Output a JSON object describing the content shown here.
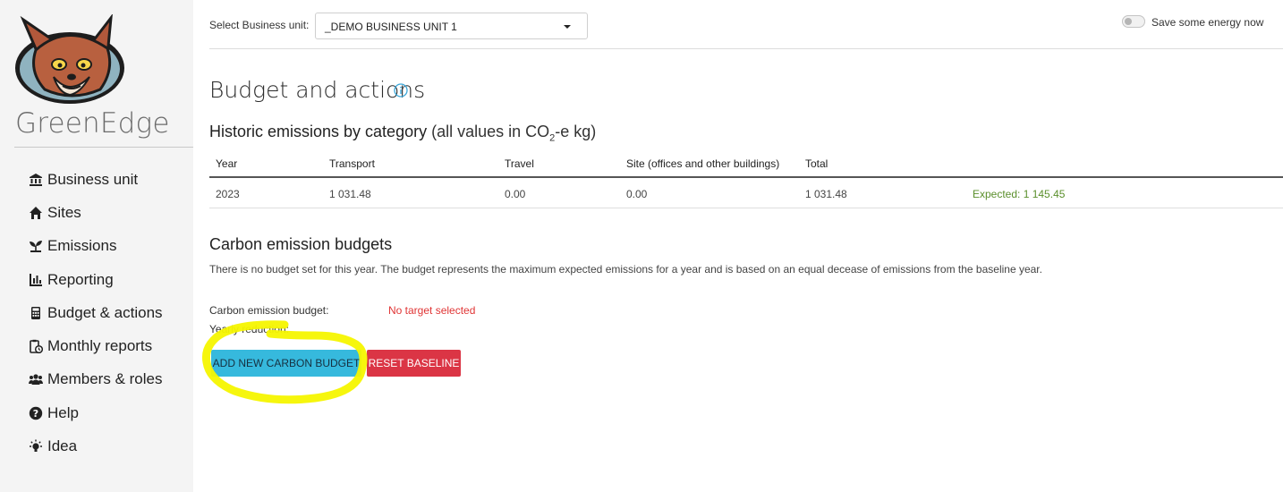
{
  "brand": {
    "name": "GreenEdge"
  },
  "nav": {
    "items": [
      {
        "label": "Business unit",
        "icon": "bank-icon"
      },
      {
        "label": "Sites",
        "icon": "home-icon"
      },
      {
        "label": "Emissions",
        "icon": "seedling-icon"
      },
      {
        "label": "Reporting",
        "icon": "bar-chart-icon"
      },
      {
        "label": "Budget & actions",
        "icon": "calculator-icon"
      },
      {
        "label": "Monthly reports",
        "icon": "report-clock-icon"
      },
      {
        "label": "Members & roles",
        "icon": "users-icon"
      },
      {
        "label": "Help",
        "icon": "question-circle-icon"
      },
      {
        "label": "Idea",
        "icon": "lightbulb-icon"
      }
    ]
  },
  "topbar": {
    "select_label": "Select Business unit:",
    "selected_unit": "_DEMO BUSINESS UNIT 1",
    "energy_label": "Save some energy now",
    "energy_on": false
  },
  "page": {
    "title": "Budget and actions",
    "historic": {
      "title": "Historic emissions by category",
      "subtitle_prefix": "(all values in CO",
      "subtitle_sub": "2",
      "subtitle_suffix": "-e kg)",
      "columns": [
        "Year",
        "Transport",
        "Travel",
        "Site (offices and other buildings)",
        "Total",
        ""
      ],
      "rows": [
        {
          "year": "2023",
          "transport": "1 031.48",
          "travel": "0.00",
          "site": "0.00",
          "total": "1 031.48",
          "expected": "Expected: 1 145.45"
        }
      ]
    },
    "budgets": {
      "title": "Carbon emission budgets",
      "description": "There is no budget set for this year. The budget represents the maximum expected emissions for a year and is based on an equal decease of emissions from the baseline year.",
      "budget_label": "Carbon emission budget:",
      "budget_value": "No target selected",
      "reduction_label": "Yearly reduction:",
      "add_button": "ADD NEW CARBON BUDGET",
      "reset_button": "RESET BASELINE"
    }
  },
  "colors": {
    "accent_blue": "#36b9dd",
    "danger_red": "#db3545",
    "expected_green": "#5a8f2b",
    "highlight_yellow": "#f5f500"
  }
}
